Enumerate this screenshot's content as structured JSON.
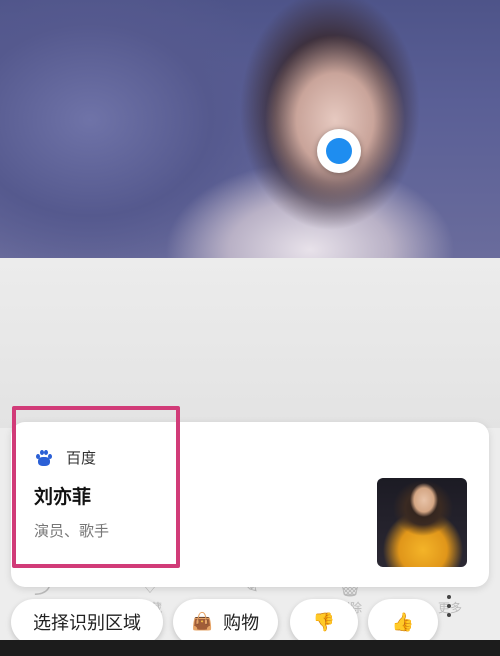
{
  "card": {
    "source": "百度",
    "name": "刘亦菲",
    "description": "演员、歌手"
  },
  "tools": [
    "收藏",
    "删除",
    "更多"
  ],
  "actions": {
    "select_region": "选择识别区域",
    "shopping": "购物",
    "dislike_icon": "thumbs-down-icon",
    "like_icon": "thumbs-up-icon"
  },
  "colors": {
    "highlight": "#d13b78",
    "focus_dot": "#1e8df0",
    "baidu_blue": "#2b60d6"
  }
}
